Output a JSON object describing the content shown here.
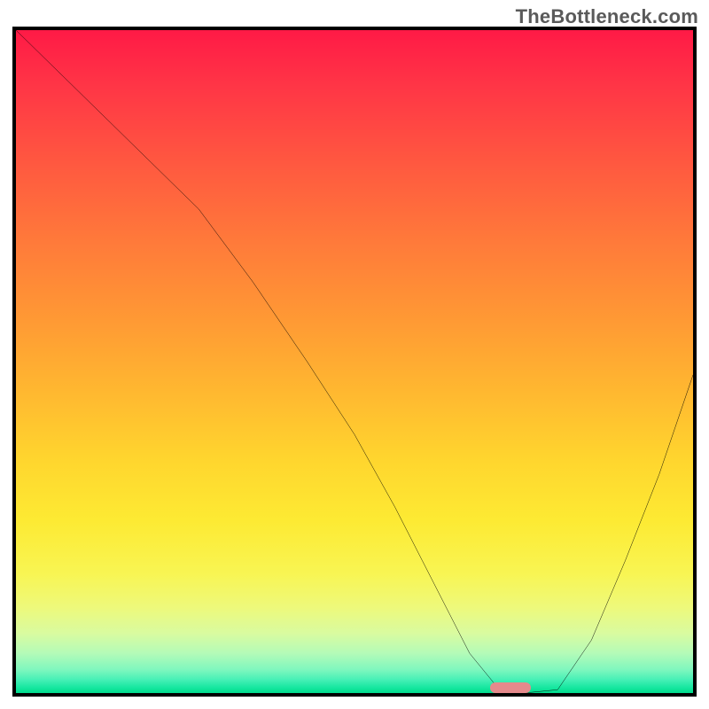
{
  "watermark": "TheBottleneck.com",
  "chart_data": {
    "type": "line",
    "title": "",
    "xlabel": "",
    "ylabel": "",
    "xlim": [
      0,
      100
    ],
    "ylim": [
      0,
      100
    ],
    "x": [
      0,
      10,
      20,
      27,
      35,
      43,
      50,
      56,
      60,
      64,
      67,
      71,
      75,
      80,
      85,
      90,
      95,
      100
    ],
    "values": [
      100,
      90,
      80,
      73,
      62,
      50,
      39,
      28,
      20,
      12,
      6,
      1,
      0,
      0.5,
      8,
      20,
      33,
      48
    ],
    "optimum_marker": {
      "x": 73,
      "y": 0,
      "width": 6,
      "height": 1.6
    },
    "colors": {
      "top": "#ff1a46",
      "mid": "#ffd62e",
      "bottom": "#00dc8c",
      "curve": "#000000",
      "marker": "#e58a8c",
      "frame": "#000000"
    }
  }
}
